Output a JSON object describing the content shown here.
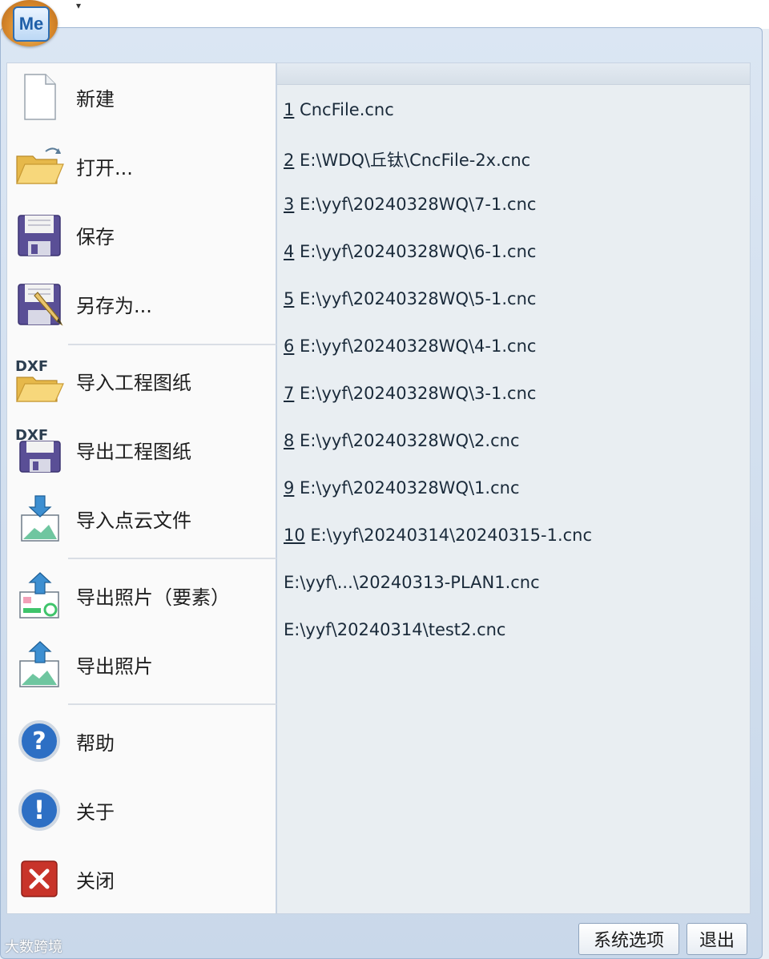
{
  "app": {
    "orb_label": "Me",
    "quick_access_arrow": "▾"
  },
  "commands": [
    {
      "id": "new",
      "label": "新建",
      "icon": "new-file-icon"
    },
    {
      "id": "open",
      "label": "打开...",
      "icon": "open-folder-icon"
    },
    {
      "id": "save",
      "label": "保存",
      "icon": "save-disk-icon"
    },
    {
      "id": "save-as",
      "label": "另存为...",
      "icon": "save-as-icon"
    },
    {
      "id": "import-drawing",
      "label": "导入工程图纸",
      "icon": "dxf-import-icon"
    },
    {
      "id": "export-drawing",
      "label": "导出工程图纸",
      "icon": "dxf-export-icon"
    },
    {
      "id": "import-pointcloud",
      "label": "导入点云文件",
      "icon": "import-image-icon"
    },
    {
      "id": "export-photo-elements",
      "label": "导出照片（要素）",
      "icon": "export-photo-elements-icon"
    },
    {
      "id": "export-photo",
      "label": "导出照片",
      "icon": "export-photo-icon"
    },
    {
      "id": "help",
      "label": "帮助",
      "icon": "help-icon"
    },
    {
      "id": "about",
      "label": "关于",
      "icon": "info-icon"
    },
    {
      "id": "close",
      "label": "关闭",
      "icon": "close-icon"
    }
  ],
  "recent_files": [
    {
      "num": "1",
      "path": " CncFile.cnc"
    },
    {
      "num": "2",
      "path": " E:\\WDQ\\丘钛\\CncFile-2x.cnc"
    },
    {
      "num": "3",
      "path": " E:\\yyf\\20240328WQ\\7-1.cnc"
    },
    {
      "num": "4",
      "path": " E:\\yyf\\20240328WQ\\6-1.cnc"
    },
    {
      "num": "5",
      "path": " E:\\yyf\\20240328WQ\\5-1.cnc"
    },
    {
      "num": "6",
      "path": " E:\\yyf\\20240328WQ\\4-1.cnc"
    },
    {
      "num": "7",
      "path": " E:\\yyf\\20240328WQ\\3-1.cnc"
    },
    {
      "num": "8",
      "path": " E:\\yyf\\20240328WQ\\2.cnc"
    },
    {
      "num": "9",
      "path": " E:\\yyf\\20240328WQ\\1.cnc"
    },
    {
      "num": "10",
      "path": " E:\\yyf\\20240314\\20240315-1.cnc"
    },
    {
      "num": "",
      "path": "E:\\yyf\\...\\20240313-PLAN1.cnc"
    },
    {
      "num": "",
      "path": "E:\\yyf\\20240314\\test2.cnc"
    }
  ],
  "footer": {
    "options_label": "系统选项",
    "exit_label": "退出"
  },
  "watermark": "大数跨境",
  "colors": {
    "accent": "#2f6fb3",
    "close_red": "#c8342a",
    "help_blue": "#2d6fc4"
  }
}
